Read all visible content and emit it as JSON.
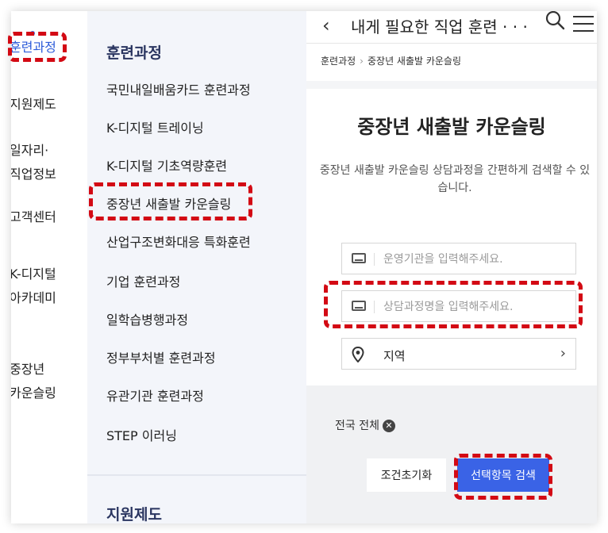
{
  "left_nav": {
    "items": [
      {
        "label": "훈련과정"
      },
      {
        "label": "지원제도"
      },
      {
        "label": "일자리·\n직업정보"
      },
      {
        "label": "고객센터"
      },
      {
        "label": "K-디지털\n아카데미"
      },
      {
        "label": "중장년\n카운슬링"
      }
    ]
  },
  "sub_nav": {
    "heading": "훈련과정",
    "items": [
      {
        "label": "국민내일배움카드 훈련과정"
      },
      {
        "label": "K-디지털 트레이닝"
      },
      {
        "label": "K-디지털 기초역량훈련"
      },
      {
        "label": "중장년 새출발 카운슬링"
      },
      {
        "label": "산업구조변화대응 특화훈련"
      },
      {
        "label": "기업 훈련과정"
      },
      {
        "label": "일학습병행과정"
      },
      {
        "label": "정부부처별 훈련과정"
      },
      {
        "label": "유관기관 훈련과정"
      },
      {
        "label": "STEP 이러닝"
      }
    ],
    "next_heading": "지원제도"
  },
  "top_bar": {
    "title": "내게 필요한 직업 훈련 · · ·"
  },
  "breadcrumb": {
    "home": "훈련과정",
    "sep": "›",
    "current": "중장년 새출발 카운슬링"
  },
  "page": {
    "title": "중장년 새출발 카운슬링",
    "description": "중장년 새출발 카운슬링 상담과정을 간편하게 검색할 수 있습니다."
  },
  "form": {
    "org_placeholder": "운영기관을 입력해주세요.",
    "course_placeholder": "상담과정명을 입력해주세요.",
    "region_label": "지역"
  },
  "filter": {
    "tag": "전국 전체",
    "reset_label": "조건초기화",
    "search_label": "선택항목 검색"
  },
  "colors": {
    "accent": "#3a63e6",
    "highlight": "#d30a14",
    "sub_nav_bg": "#f3f5fa"
  }
}
